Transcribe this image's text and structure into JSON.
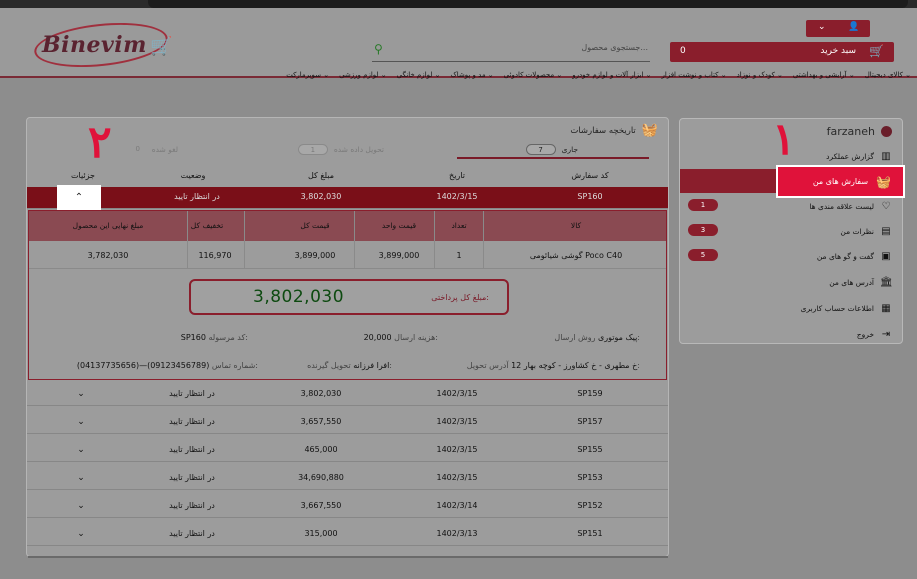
{
  "header": {
    "logo_text": "Binevim",
    "search_placeholder": "جستجوی محصول...",
    "cart_label": "سبد خرید",
    "cart_count": "0",
    "nav": [
      "کالای دیجیتال",
      "آرایشی و بهداشتی",
      "کودک و نوزاد",
      "کتاب و نوشت افزار",
      "ابزار آلات و لوازم خودرو",
      "محصولات کادوئی",
      "مد و پوشاک",
      "لوازم خانگی",
      "لوازم ورزشی",
      "سوپرمارکت"
    ]
  },
  "sidebar": {
    "username": "farzaneh",
    "items": [
      {
        "label": "گزارش عملکرد",
        "icon": "chart-icon",
        "badge": ""
      },
      {
        "label": "سفارش های من",
        "icon": "basket-icon",
        "badge": ""
      },
      {
        "label": "لیست علاقه مندی ها",
        "icon": "heart-icon",
        "badge": "1"
      },
      {
        "label": "نظرات من",
        "icon": "comment-icon",
        "badge": "3"
      },
      {
        "label": "گفت و گو های من",
        "icon": "chat-icon",
        "badge": "5"
      },
      {
        "label": "آدرس های من",
        "icon": "bank-icon",
        "badge": ""
      },
      {
        "label": "اطلاعات حساب کاربری",
        "icon": "contact-icon",
        "badge": ""
      },
      {
        "label": "خروج",
        "icon": "logout-icon",
        "badge": ""
      }
    ],
    "marker": "۱"
  },
  "orders": {
    "title": "تاریخچه سفارشات",
    "tabs": [
      {
        "label": "جاری",
        "count": "7"
      },
      {
        "label": "تحویل داده شده",
        "count": "1"
      },
      {
        "label": "لغو شده",
        "count": "0"
      }
    ],
    "columns": [
      "کد سفارش",
      "تاریخ",
      "مبلغ کل",
      "وضعیت",
      "جزئیات"
    ],
    "marker": "۲",
    "active_row": {
      "code": "SP160",
      "date": "1402/3/15",
      "total": "3,802,030",
      "status": "در انتظار تایید"
    },
    "detail": {
      "columns": [
        "کالا",
        "تعداد",
        "قیمت واحد",
        "قیمت کل",
        "تخفیف کل",
        "مبلغ نهایی این محصول"
      ],
      "item": {
        "name": "گوشی شیائومی Poco C40",
        "qty": "1",
        "unit": "3,899,000",
        "total": "3,899,000",
        "discount": "116,970",
        "final": "3,782,030"
      },
      "pay_label": "مبلغ کل پرداختی:",
      "pay_value": "3,802,030",
      "shipping_method_label": "روش ارسال:",
      "shipping_method": "پیک موتوری",
      "shipping_cost_label": "هزینه ارسال:",
      "shipping_cost": "20,000",
      "tracking_label": "کد مرسوله:",
      "tracking": "SP160",
      "address_label": "آدرس تحویل:",
      "address": "خ مطهری - خ کشاورز - کوچه بهار 12",
      "receiver_label": "تحویل گیرنده:",
      "receiver": "افرا فرزانه",
      "phone_label": "شماره تماس:",
      "phone": "(04137735656)—(09123456789)"
    },
    "rows": [
      {
        "code": "SP159",
        "date": "1402/3/15",
        "total": "3,802,030",
        "status": "در انتظار تایید"
      },
      {
        "code": "SP157",
        "date": "1402/3/15",
        "total": "3,657,550",
        "status": "در انتظار تایید"
      },
      {
        "code": "SP155",
        "date": "1402/3/15",
        "total": "465,000",
        "status": "در انتظار تایید"
      },
      {
        "code": "SP153",
        "date": "1402/3/15",
        "total": "34,690,880",
        "status": "در انتظار تایید"
      },
      {
        "code": "SP152",
        "date": "1402/3/14",
        "total": "3,667,550",
        "status": "در انتظار تایید"
      },
      {
        "code": "SP151",
        "date": "1402/3/13",
        "total": "315,000",
        "status": "در انتظار تایید"
      }
    ]
  },
  "colors": {
    "accent": "#8a1e2c",
    "highlight": "#e0123a",
    "pay_value": "#0d4a10"
  }
}
